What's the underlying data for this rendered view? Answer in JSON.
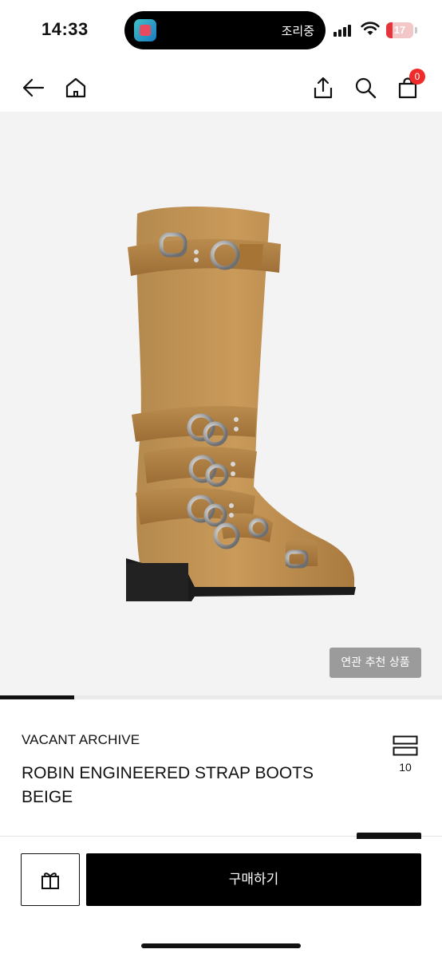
{
  "status_bar": {
    "time": "14:33",
    "island_text": "조리중",
    "battery_level": "17",
    "battery_color": "#e5343b"
  },
  "nav": {
    "back_icon": "arrow-left-icon",
    "home_icon": "home-icon",
    "share_icon": "share-icon",
    "search_icon": "search-icon",
    "cart_icon": "shopping-bag-icon",
    "cart_count": "0",
    "badge_color": "#f02b2b"
  },
  "gallery": {
    "image_alt": "boot-image",
    "related_button_label": "연관 추천 상품",
    "progress": 0.167
  },
  "product": {
    "brand": "VACANT ARCHIVE",
    "name": "ROBIN ENGINEERED STRAP BOOTS BEIGE",
    "wishlist_count": "10"
  },
  "actions": {
    "gift_icon": "gift-icon",
    "buy_label": "구매하기"
  }
}
